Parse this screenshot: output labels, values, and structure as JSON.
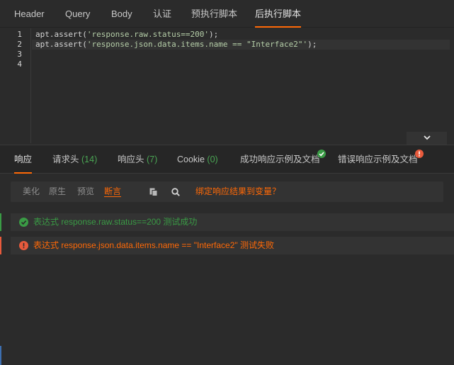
{
  "top_tabs": {
    "items": [
      {
        "label": "Header"
      },
      {
        "label": "Query"
      },
      {
        "label": "Body"
      },
      {
        "label": "认证"
      },
      {
        "label": "预执行脚本"
      },
      {
        "label": "后执行脚本"
      }
    ],
    "active": "后执行脚本"
  },
  "editor": {
    "line_numbers": [
      "1",
      "2",
      "3",
      "4"
    ],
    "lines": [
      {
        "pre": "apt.assert(",
        "str": "'response.raw.status==200'",
        "post": ");"
      },
      {
        "pre": "apt.assert(",
        "str": "'response.json.data.items.name == \"Interface2\"'",
        "post": ");"
      }
    ]
  },
  "response_tabs": {
    "items": [
      {
        "label": "响应",
        "count": ""
      },
      {
        "label": "请求头",
        "count": "(14)"
      },
      {
        "label": "响应头",
        "count": "(7)"
      },
      {
        "label": "Cookie",
        "count": "(0)"
      },
      {
        "label": "成功响应示例及文档",
        "count": ""
      },
      {
        "label": "错误响应示例及文档",
        "count": ""
      }
    ],
    "active": "响应"
  },
  "toolbar": {
    "segments": [
      "美化",
      "原生",
      "预览",
      "断言"
    ],
    "active": "断言",
    "bind_label": "绑定响应结果到变量？"
  },
  "results": [
    {
      "status": "success",
      "text": "表达式 response.raw.status==200 测试成功"
    },
    {
      "status": "failure",
      "text": "表达式 response.json.data.items.name == \"Interface2\" 测试失败"
    }
  ],
  "colors": {
    "accent": "#ff6907",
    "success": "#3a9b45",
    "error": "#e85a3c",
    "background": "#2b2b2b"
  },
  "icons": {
    "collapse": "chevron-down-icon",
    "copy": "copy-icon",
    "search": "search-icon",
    "success_badge": "check-circle-icon",
    "error_badge": "exclamation-circle-icon"
  }
}
